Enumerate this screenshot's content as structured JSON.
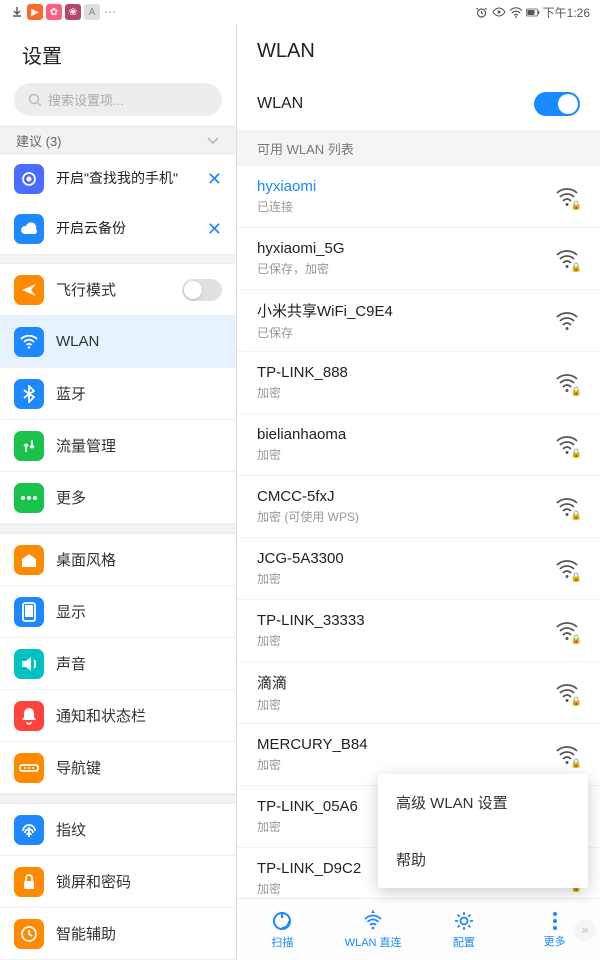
{
  "statusbar": {
    "time": "下午1:26",
    "left_icons": [
      "download",
      "app1",
      "app2",
      "app3",
      "app4",
      "more"
    ],
    "right_icons": [
      "alarm",
      "eye",
      "wifi",
      "battery"
    ]
  },
  "left": {
    "title": "设置",
    "search_placeholder": "搜索设置项...",
    "suggest_header": "建议 (3)",
    "suggestions": [
      {
        "label": "开启\"查找我的手机\"",
        "color": "#4a6cff",
        "icon": "target"
      },
      {
        "label": "开启云备份",
        "color": "#1e88ff",
        "icon": "cloud"
      }
    ],
    "groups": [
      [
        {
          "label": "飞行模式",
          "color": "#ff8a00",
          "icon": "plane",
          "toggle": false
        },
        {
          "label": "WLAN",
          "color": "#1e88ff",
          "icon": "wifi",
          "active": true
        },
        {
          "label": "蓝牙",
          "color": "#1e88ff",
          "icon": "bt"
        },
        {
          "label": "流量管理",
          "color": "#19c24b",
          "icon": "data"
        },
        {
          "label": "更多",
          "color": "#19c24b",
          "icon": "dots"
        }
      ],
      [
        {
          "label": "桌面风格",
          "color": "#ff8a00",
          "icon": "home"
        },
        {
          "label": "显示",
          "color": "#1e88ff",
          "icon": "display"
        },
        {
          "label": "声音",
          "color": "#00c2c2",
          "icon": "sound"
        },
        {
          "label": "通知和状态栏",
          "color": "#ff433f",
          "icon": "bell"
        },
        {
          "label": "导航键",
          "color": "#ff8a00",
          "icon": "nav"
        }
      ],
      [
        {
          "label": "指纹",
          "color": "#1e88ff",
          "icon": "finger"
        },
        {
          "label": "锁屏和密码",
          "color": "#ff8a00",
          "icon": "lock"
        },
        {
          "label": "智能辅助",
          "color": "#ff8a00",
          "icon": "assist"
        }
      ]
    ]
  },
  "right": {
    "title": "WLAN",
    "toggle_label": "WLAN",
    "toggle_on": true,
    "section_label": "可用 WLAN 列表",
    "networks": [
      {
        "name": "hyxiaomi",
        "sub": "已连接",
        "locked": true,
        "connected": true
      },
      {
        "name": "hyxiaomi_5G",
        "sub": "已保存，加密",
        "locked": true
      },
      {
        "name": " 小米共享WiFi_C9E4",
        "sub": "已保存",
        "locked": false
      },
      {
        "name": "TP-LINK_888",
        "sub": "加密",
        "locked": true
      },
      {
        "name": "bielianhaoma",
        "sub": "加密",
        "locked": true
      },
      {
        "name": "CMCC-5fxJ",
        "sub": "加密 (可使用 WPS)",
        "locked": true
      },
      {
        "name": "JCG-5A3300",
        "sub": "加密",
        "locked": true
      },
      {
        "name": "TP-LINK_33333",
        "sub": "加密",
        "locked": true
      },
      {
        "name": "滴滴",
        "sub": "加密",
        "locked": true
      },
      {
        "name": "MERCURY_B84",
        "sub": "加密",
        "locked": true
      },
      {
        "name": "TP-LINK_05A6",
        "sub": "加密",
        "locked": true
      },
      {
        "name": "TP-LINK_D9C2",
        "sub": "加密",
        "locked": true
      }
    ],
    "popup": {
      "item1": "高级 WLAN 设置",
      "item2": "帮助"
    },
    "bottombar": {
      "scan": "扫描",
      "direct": "WLAN 直连",
      "config": "配置",
      "more": "更多"
    }
  }
}
